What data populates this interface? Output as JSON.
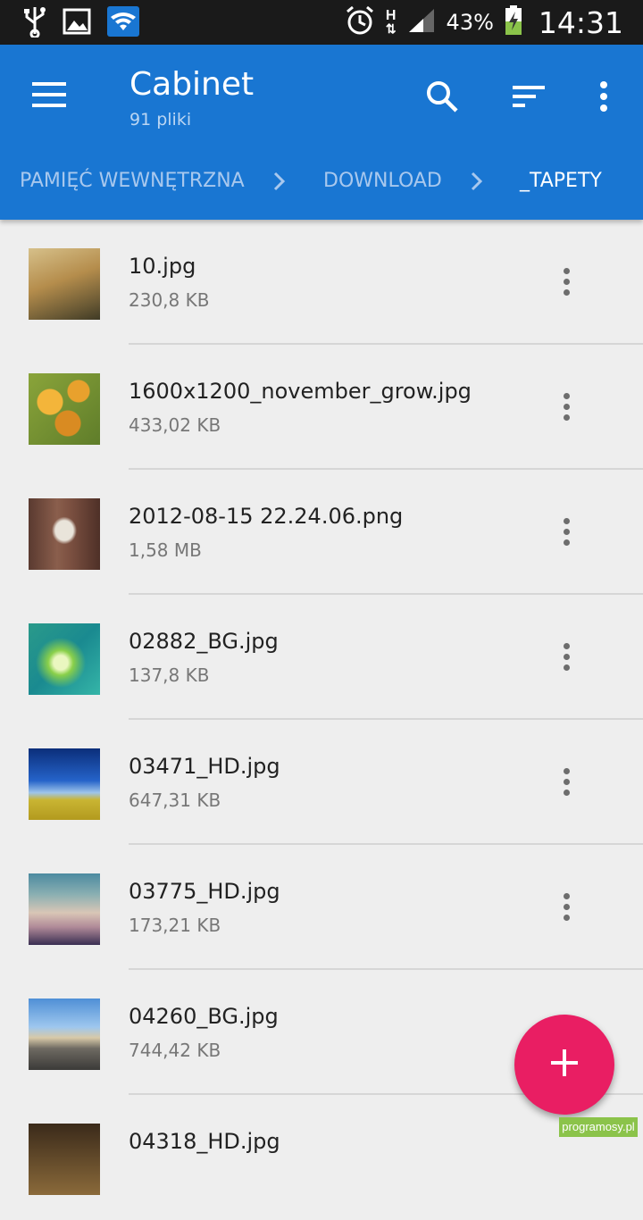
{
  "status_bar": {
    "battery": "43%",
    "clock": "14:31",
    "network_type": "H",
    "icons": [
      "usb-icon",
      "image-icon",
      "wifi-icon",
      "alarm-icon",
      "signal-icon",
      "battery-charging-icon"
    ]
  },
  "app_bar": {
    "title": "Cabinet",
    "subtitle": "91 pliki",
    "color": "#1976d2",
    "actions": [
      "menu-icon",
      "search-icon",
      "sort-icon",
      "more-vert-icon"
    ]
  },
  "breadcrumb": {
    "items": [
      "PAMIĘĆ WEWNĘTRZNA",
      "DOWNLOAD",
      "_TAPETY"
    ]
  },
  "files": [
    {
      "name": "10.jpg",
      "size": "230,8 KB"
    },
    {
      "name": "1600x1200_november_grow.jpg",
      "size": "433,02 KB"
    },
    {
      "name": "2012-08-15 22.24.06.png",
      "size": "1,58 MB"
    },
    {
      "name": "02882_BG.jpg",
      "size": "137,8 KB"
    },
    {
      "name": "03471_HD.jpg",
      "size": "647,31 KB"
    },
    {
      "name": "03775_HD.jpg",
      "size": "173,21 KB"
    },
    {
      "name": "04260_BG.jpg",
      "size": "744,42 KB"
    },
    {
      "name": "04318_HD.jpg",
      "size": ""
    }
  ],
  "fab": {
    "icon": "plus-icon",
    "color": "#e91e63"
  },
  "watermark": "programosy.pl"
}
